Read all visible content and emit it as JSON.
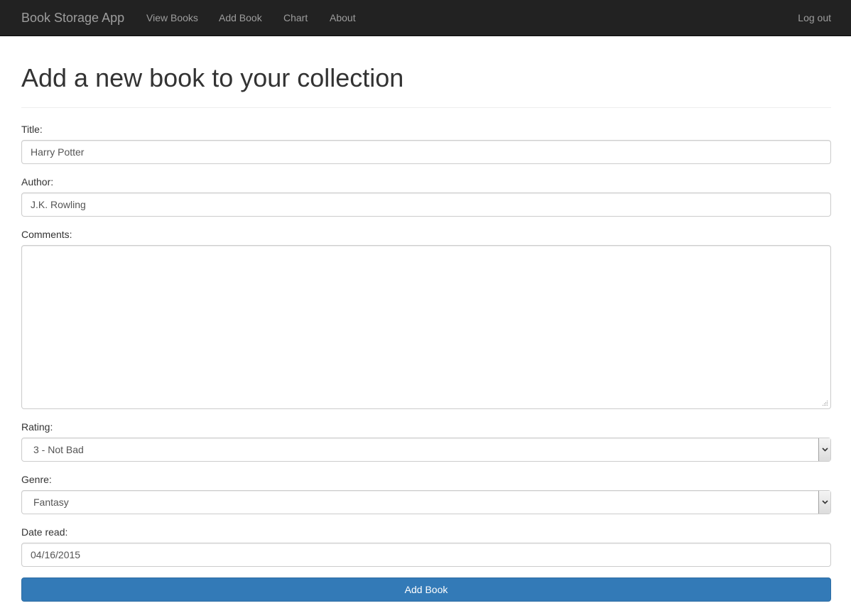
{
  "navbar": {
    "brand": "Book Storage App",
    "links": [
      "View Books",
      "Add Book",
      "Chart",
      "About"
    ],
    "logout": "Log out"
  },
  "page": {
    "title": "Add a new book to your collection"
  },
  "form": {
    "title": {
      "label": "Title:",
      "value": "Harry Potter"
    },
    "author": {
      "label": "Author:",
      "value": "J.K. Rowling"
    },
    "comments": {
      "label": "Comments:",
      "value": ""
    },
    "rating": {
      "label": "Rating:",
      "value": "3 - Not Bad"
    },
    "genre": {
      "label": "Genre:",
      "value": "Fantasy"
    },
    "date_read": {
      "label": "Date read:",
      "value": "04/16/2015"
    },
    "submit_label": "Add Book"
  },
  "colors": {
    "navbar_bg": "#222222",
    "nav_text": "#9d9d9d",
    "primary": "#337ab7"
  }
}
